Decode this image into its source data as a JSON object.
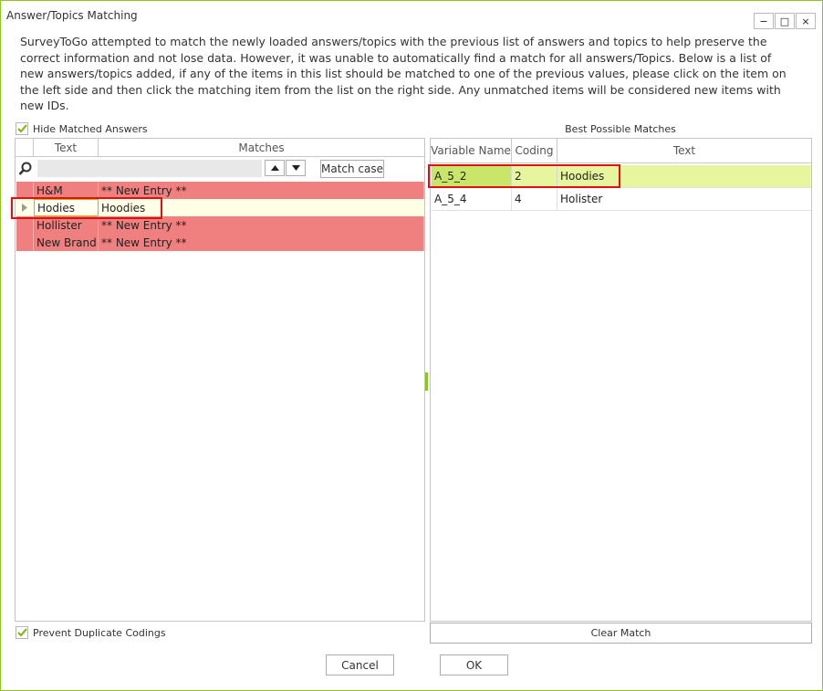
{
  "window": {
    "title": "Answer/Topics Matching",
    "controls": {
      "minimize": "−",
      "maximize": "□",
      "close": "×"
    }
  },
  "description": "SurveyToGo attempted to match the newly loaded answers/topics with the previous list of answers and topics to help preserve the correct information and not lose data. However, it was unable to automatically find a match for all answers/Topics. Below is a list of new answers/topics added, if any of the items in this list should be matched to one of the previous values, please click on the item on the left side and then click the matching item from the list on the right side. Any unmatched items will be considered new items with new IDs.",
  "left_panel": {
    "hide_matched_label": "Hide Matched Answers",
    "hide_matched_checked": true,
    "columns": {
      "text": "Text",
      "matches": "Matches"
    },
    "search": {
      "value": "",
      "placeholder": ""
    },
    "match_case_label": "Match case",
    "rows": [
      {
        "text": "H&M",
        "match": "** New Entry **",
        "state": "unmatched"
      },
      {
        "text": "Hodies",
        "match": "Hoodies",
        "state": "current"
      },
      {
        "text": "Hollister",
        "match": "** New Entry **",
        "state": "unmatched"
      },
      {
        "text": "New Brand",
        "match": "** New Entry **",
        "state": "unmatched"
      }
    ],
    "prevent_duplicates_label": "Prevent Duplicate Codings",
    "prevent_duplicates_checked": true
  },
  "right_panel": {
    "title": "Best Possible Matches",
    "columns": {
      "variable_name": "Variable Name",
      "coding": "Coding",
      "text": "Text"
    },
    "rows": [
      {
        "variable_name": "A_5_2",
        "coding": "2",
        "text": "Hoodies",
        "selected": true
      },
      {
        "variable_name": "A_5_4",
        "coding": "4",
        "text": "Holister",
        "selected": false
      }
    ],
    "clear_match_label": "Clear Match"
  },
  "footer": {
    "cancel_label": "Cancel",
    "ok_label": "OK"
  },
  "colors": {
    "accent_green": "#8fc31f",
    "unmatched_row": "#f07f7f",
    "selected_row": "#e6f59e",
    "highlight_box": "#e01010"
  }
}
